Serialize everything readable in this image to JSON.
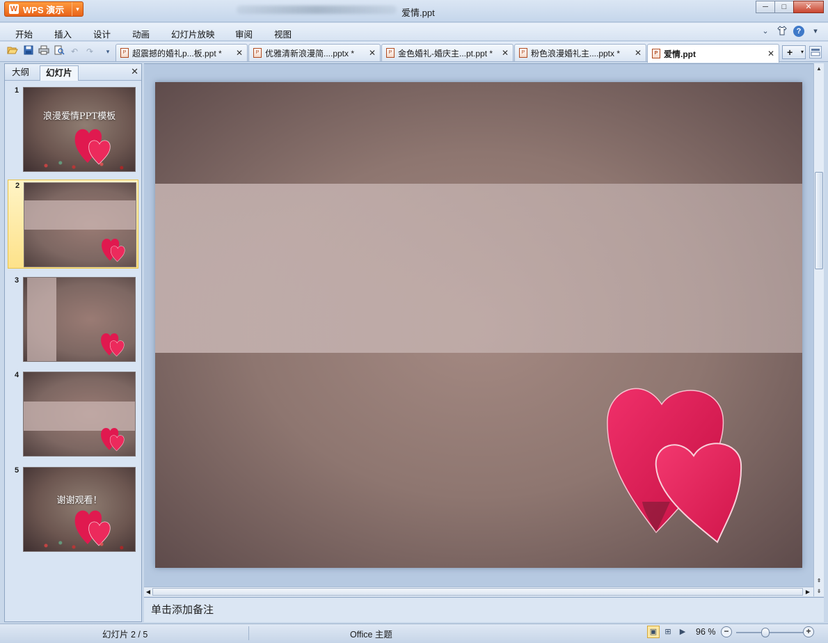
{
  "app": {
    "name": "WPS 演示",
    "logo": "W",
    "dropdown": "▾"
  },
  "window": {
    "title": "爱情.ppt",
    "minimize": "─",
    "maximize": "□",
    "close": "✕"
  },
  "menu": {
    "items": [
      "开始",
      "插入",
      "设计",
      "动画",
      "幻灯片放映",
      "审阅",
      "视图"
    ],
    "right_icons": [
      "chevron-down-icon",
      "shirt-icon",
      "help-icon"
    ],
    "chevron": "⌄",
    "skin": "👕",
    "help": "?",
    "help_dd": "▾"
  },
  "quick_access": {
    "open": "📂",
    "save": "💾",
    "print": "🖶",
    "preview": "🔍",
    "undo": "↶",
    "redo": "↷",
    "more": "▾"
  },
  "tabs": [
    {
      "label": "超震撼的婚礼p...板.ppt *",
      "close": "✕"
    },
    {
      "label": "优雅清新浪漫简....pptx *",
      "close": "✕"
    },
    {
      "label": "金色婚礼-婚庆主...pt.ppt *",
      "close": "✕"
    },
    {
      "label": "粉色浪漫婚礼主....pptx *",
      "close": "✕"
    },
    {
      "label": "爱情.ppt",
      "close": "✕"
    }
  ],
  "new_tab": {
    "plus": "+",
    "dd": "▾"
  },
  "left_pane": {
    "tabs": [
      "大纲",
      "幻灯片"
    ],
    "close": "✕",
    "thumbnails": [
      {
        "num": "1",
        "caption": "浪漫爱情PPT模板"
      },
      {
        "num": "2",
        "caption": ""
      },
      {
        "num": "3",
        "caption": ""
      },
      {
        "num": "4",
        "caption": ""
      },
      {
        "num": "5",
        "caption": "谢谢观看！"
      }
    ],
    "selected": 2
  },
  "scroll": {
    "up": "▲",
    "down": "▼",
    "left": "◀",
    "right": "▶",
    "prev": "⇞",
    "next": "⇟"
  },
  "notes": {
    "placeholder": "单击添加备注"
  },
  "status": {
    "slide": "幻灯片 2 / 5",
    "theme": "Office 主题",
    "zoom": "96 %",
    "zoom_value": 96,
    "zoom_out": "−",
    "zoom_in": "+",
    "view_icons": {
      "normal": "▣",
      "sorter": "⊞",
      "show": "▶"
    }
  },
  "colors": {
    "accent": "#e8631a",
    "heart": "#e0194f",
    "slide_bg": "#8e7670"
  }
}
